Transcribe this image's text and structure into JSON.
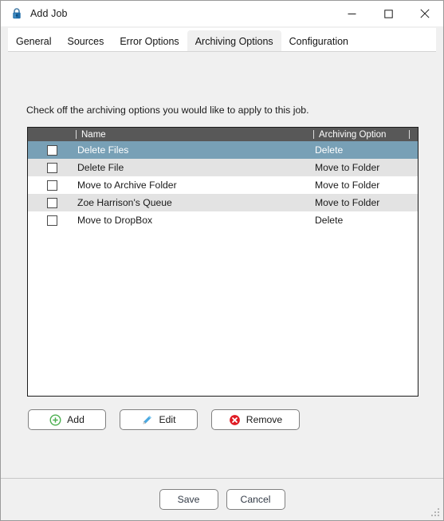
{
  "window": {
    "title": "Add Job",
    "icon": "padlock-icon",
    "controls": {
      "minimize": "minimize-icon",
      "maximize": "maximize-icon",
      "close": "close-icon"
    }
  },
  "tabs": [
    {
      "label": "General",
      "active": false
    },
    {
      "label": "Sources",
      "active": false
    },
    {
      "label": "Error Options",
      "active": false
    },
    {
      "label": "Archiving Options",
      "active": true
    },
    {
      "label": "Configuration",
      "active": false
    }
  ],
  "main": {
    "instruction": "Check off the archiving options you would like to apply to this job.",
    "list": {
      "columns": [
        "",
        "Name",
        "Archiving Option",
        ""
      ],
      "header_name": "Name",
      "header_option": "Archiving Option",
      "rows": [
        {
          "checked": false,
          "name": "Delete Files",
          "option": "Delete",
          "state": "selected"
        },
        {
          "checked": false,
          "name": "Delete File",
          "option": "Move to Folder",
          "state": "alt"
        },
        {
          "checked": false,
          "name": "Move to Archive Folder",
          "option": "Move to Folder",
          "state": "plain"
        },
        {
          "checked": false,
          "name": "Zoe Harrison's Queue",
          "option": "Move to Folder",
          "state": "alt"
        },
        {
          "checked": false,
          "name": "Move to DropBox",
          "option": "Delete",
          "state": "plain"
        }
      ]
    },
    "actions": [
      {
        "label": "Add",
        "icon": "add-circle-icon",
        "color": "#4caf50"
      },
      {
        "label": "Edit",
        "icon": "pencil-icon",
        "color": "#4aa8e0"
      },
      {
        "label": "Remove",
        "icon": "remove-circle-icon",
        "color": "#e01b24"
      }
    ]
  },
  "footer": {
    "save_label": "Save",
    "cancel_label": "Cancel",
    "grip": "resize-grip-icon"
  },
  "colors": {
    "selection": "#78a0b6",
    "header_bar": "#585858",
    "alt_row": "#e3e3e3",
    "window_bg": "#f0f0f0"
  }
}
